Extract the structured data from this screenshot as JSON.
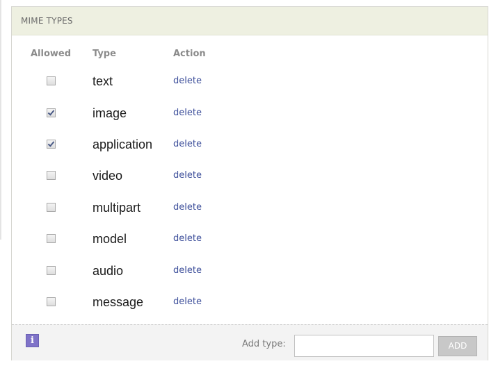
{
  "panel": {
    "title": "MIME TYPES",
    "columns": {
      "allowed": "Allowed",
      "type": "Type",
      "action": "Action"
    },
    "rows": [
      {
        "type": "text",
        "allowed": false,
        "action": "delete"
      },
      {
        "type": "image",
        "allowed": true,
        "action": "delete"
      },
      {
        "type": "application",
        "allowed": true,
        "action": "delete"
      },
      {
        "type": "video",
        "allowed": false,
        "action": "delete"
      },
      {
        "type": "multipart",
        "allowed": false,
        "action": "delete"
      },
      {
        "type": "model",
        "allowed": false,
        "action": "delete"
      },
      {
        "type": "audio",
        "allowed": false,
        "action": "delete"
      },
      {
        "type": "message",
        "allowed": false,
        "action": "delete"
      }
    ],
    "footer": {
      "info_icon": "info-icon",
      "add_label": "Add type:",
      "add_value": "",
      "add_button": "ADD"
    }
  }
}
